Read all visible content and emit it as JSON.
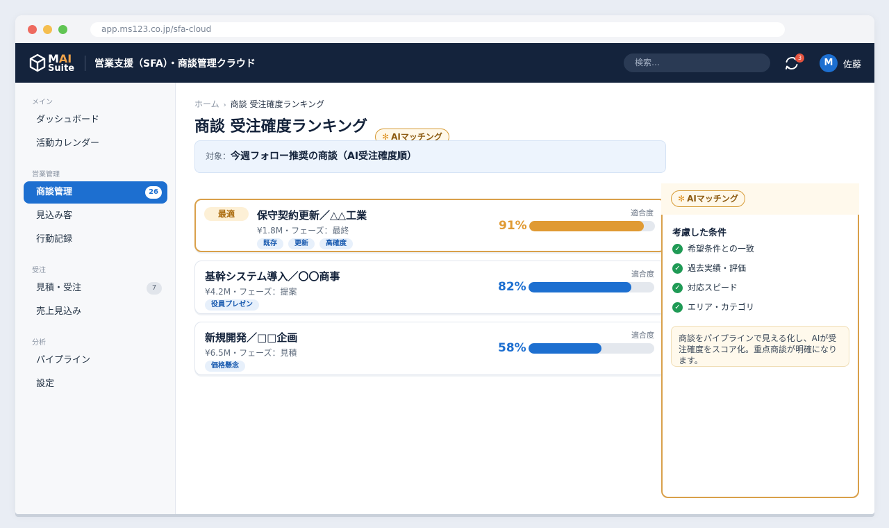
{
  "browser": {
    "url": "app.ms123.co.jp/sfa-cloud"
  },
  "brand": {
    "logo_m": "M",
    "logo_ai": "AI",
    "logo_suite": "Suite",
    "accent": "#f0a34a"
  },
  "header": {
    "app_title": "営業支援（SFA）・商談管理クラウド",
    "search_placeholder": "検索…",
    "notification_count": "3",
    "user_initial": "M",
    "user_name": "佐藤",
    "bg_color": "#14233c"
  },
  "sidebar": {
    "sections": [
      {
        "label": "メイン",
        "items": [
          {
            "label": "ダッシュボード"
          },
          {
            "label": "活動カレンダー"
          }
        ]
      },
      {
        "label": "営業管理",
        "items": [
          {
            "label": "商談管理",
            "count": "26",
            "active": true
          },
          {
            "label": "見込み客"
          },
          {
            "label": "行動記録"
          }
        ]
      },
      {
        "label": "受注",
        "items": [
          {
            "label": "見積・受注",
            "count": "7"
          },
          {
            "label": "売上見込み"
          }
        ]
      },
      {
        "label": "分析",
        "items": [
          {
            "label": "パイプライン"
          },
          {
            "label": "設定"
          }
        ]
      }
    ],
    "active_color": "#1d6fd0"
  },
  "main": {
    "breadcrumb": {
      "home": "ホーム",
      "separator": "›",
      "current": "商談 受注確度ランキング"
    },
    "title": "商談 受注確度ランキング",
    "ai_badge": "AIマッチング",
    "target_label": "対象：",
    "target_value": "今週フォロー推奨の商談（AI受注確度順）",
    "fit_label": "適合度",
    "deals": [
      {
        "badge": "最適",
        "name": "保守契約更新／△△工業",
        "meta": "¥1.8M・フェーズ：最終",
        "tags": [
          "既存",
          "更新",
          "高確度"
        ],
        "score_text": "91%",
        "score": 0.91,
        "color": "#e09a33"
      },
      {
        "name": "基幹システム導入／〇〇商事",
        "meta": "¥4.2M・フェーズ：提案",
        "tags": [
          "役員プレゼン"
        ],
        "score_text": "82%",
        "score": 0.82,
        "color": "#1d6fd0"
      },
      {
        "name": "新規開発／□□企画",
        "meta": "¥6.5M・フェーズ：見積",
        "tags": [
          "価格懸念"
        ],
        "score_text": "58%",
        "score": 0.58,
        "color": "#1d6fd0"
      }
    ]
  },
  "panel": {
    "badge": "AIマッチング",
    "title": "考慮した条件",
    "conditions": [
      "希望条件との一致",
      "過去実績・評価",
      "対応スピード",
      "エリア・カテゴリ"
    ],
    "note": "商談をパイプラインで見える化し、AIが受注確度をスコア化。重点商談が明確になります。"
  }
}
